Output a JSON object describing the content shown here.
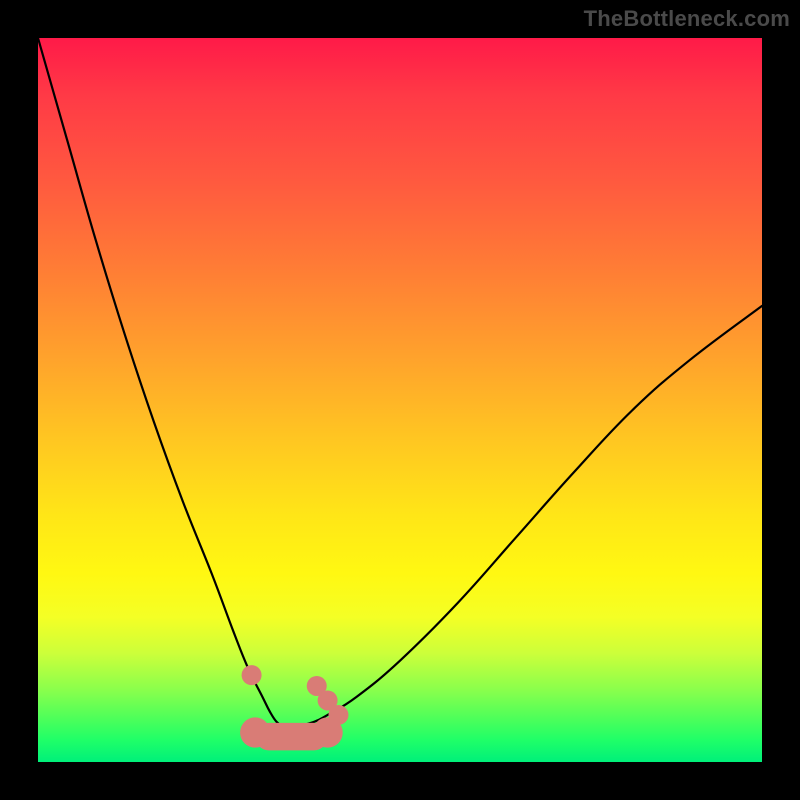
{
  "watermark": "TheBottleneck.com",
  "colors": {
    "background": "#000000",
    "curve": "#000000",
    "markers": "#d97c76",
    "gradient_top": "#ff1a48",
    "gradient_bottom": "#00f07a"
  },
  "chart_data": {
    "type": "line",
    "title": "",
    "xlabel": "",
    "ylabel": "",
    "xlim": [
      0,
      100
    ],
    "ylim": [
      0,
      100
    ],
    "grid": false,
    "legend": false,
    "series": [
      {
        "name": "bottleneck-curve",
        "x": [
          0,
          4,
          8,
          12,
          16,
          20,
          24,
          27,
          29,
          31,
          32,
          33,
          34,
          36,
          38,
          40,
          44,
          50,
          58,
          66,
          74,
          82,
          90,
          100
        ],
        "y": [
          100,
          86,
          72,
          59,
          47,
          36,
          26,
          18,
          13,
          9,
          7,
          5.5,
          5,
          5,
          5.5,
          6.5,
          9,
          14,
          22,
          31,
          40,
          48.5,
          55.5,
          63
        ]
      }
    ],
    "markers": [
      {
        "name": "left-dot",
        "x": 29.5,
        "y": 12
      },
      {
        "name": "right-dot-1",
        "x": 38.5,
        "y": 10.5
      },
      {
        "name": "right-dot-2",
        "x": 40.0,
        "y": 8.5
      },
      {
        "name": "right-dot-3",
        "x": 41.5,
        "y": 6.5
      }
    ],
    "valley_bar": {
      "x0": 30,
      "x1": 40,
      "y": 3.5,
      "thickness_pct": 3.8
    },
    "annotations": []
  }
}
